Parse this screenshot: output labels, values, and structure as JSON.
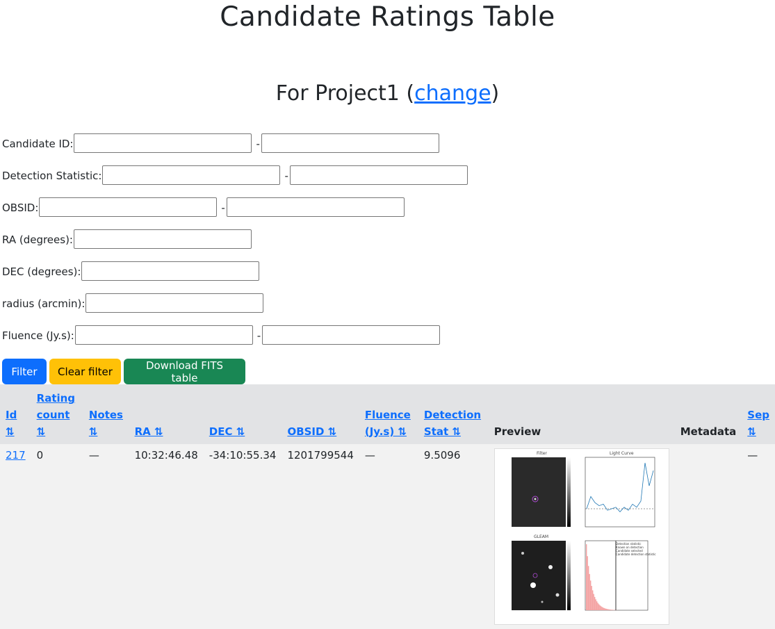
{
  "page": {
    "title": "Candidate Ratings Table",
    "subtitle_prefix": "For Project1 (",
    "change_link": "change",
    "subtitle_suffix": ")"
  },
  "filters": [
    {
      "label": "Candidate ID:",
      "range": true
    },
    {
      "label": "Detection Statistic:",
      "range": true
    },
    {
      "label": "OBSID:",
      "range": true
    },
    {
      "label": "RA (degrees):",
      "range": false
    },
    {
      "label": "DEC (degrees):",
      "range": false
    },
    {
      "label": "radius (arcmin):",
      "range": false
    },
    {
      "label": "Fluence (Jy.s):",
      "range": true
    }
  ],
  "filter_dash": "-",
  "buttons": {
    "filter": "Filter",
    "clear": "Clear filter",
    "download": "Download FITS table"
  },
  "table": {
    "headers": {
      "id": "Id",
      "rating_count_1": "Rating",
      "rating_count_2": "count ⇅",
      "notes_1": "Notes",
      "notes_2": "⇅",
      "ra": "RA ⇅",
      "dec": "DEC ⇅",
      "obsid": "OBSID ⇅",
      "fluence_1": "Fluence",
      "fluence_2": "(Jy.s) ⇅",
      "detection_1": "Detection",
      "detection_2": "Stat ⇅",
      "preview": "Preview",
      "metadata": "Metadata",
      "sep_1": "Sep",
      "sep_2": "⇅",
      "id_sort": "⇅"
    },
    "rows": [
      {
        "id": "217",
        "rating_count": "0",
        "notes": "—",
        "ra": "10:32:46.48",
        "dec": "-34:10:55.34",
        "obsid": "1201799544",
        "fluence": "—",
        "detection_stat": "9.5096",
        "metadata": "",
        "sep": "—"
      }
    ]
  },
  "preview_panels": {
    "filter_title": "Filter",
    "lightcurve_title": "Light Curve",
    "glean_title": "GLEAM",
    "hist_legend": [
      "Detection statistic",
      "Known on detection",
      "Candidate selected",
      "Candidate detection statistic"
    ],
    "lightcurve_values": [
      0,
      0.8,
      0.4,
      0.2,
      0.3,
      -0.1,
      0,
      0.1,
      -0.2,
      0.1,
      -0.1,
      0.3,
      0.1,
      0.5,
      3.0,
      1.5,
      2.5
    ]
  },
  "colors": {
    "primary": "#0d6efd",
    "warning": "#ffc107",
    "success": "#198754",
    "table_header_bg": "#e2e3e5",
    "row_bg": "#f2f2f2"
  }
}
